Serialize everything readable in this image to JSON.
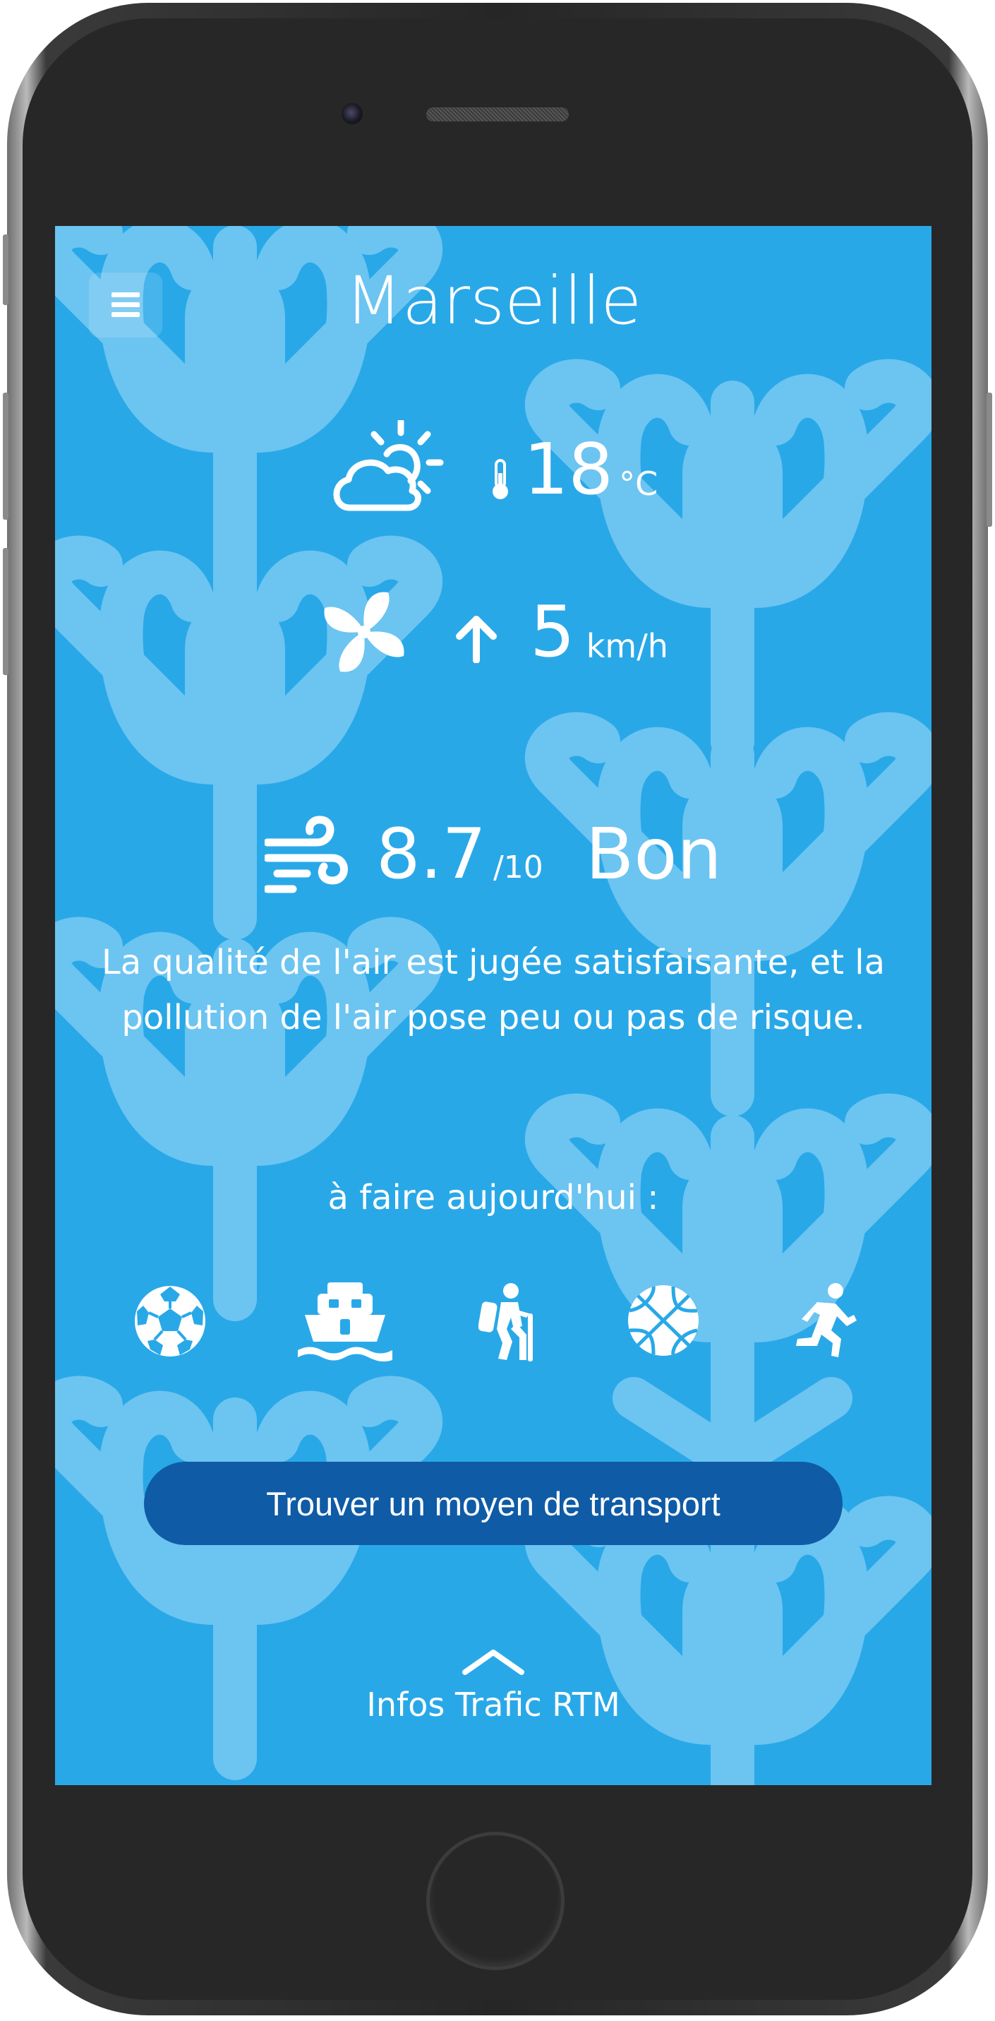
{
  "header": {
    "city": "Marseille",
    "menu_icon": "hamburger-menu-icon"
  },
  "weather": {
    "condition_icon": "partly-cloudy-sun-icon",
    "temperature": "18",
    "temperature_unit": "°C",
    "wind_icon": "wind-fan-icon",
    "wind_direction_icon": "arrow-up-icon",
    "wind_speed": "5",
    "wind_speed_unit": "km/h"
  },
  "air_quality": {
    "icon": "air-wind-icon",
    "score": "8.7",
    "scale": "/10",
    "label": "Bon",
    "description": "La qualité de l'air est jugée satisfaisante, et la pollution de l'air pose peu ou pas de risque."
  },
  "activities": {
    "label": "à faire aujourd'hui :",
    "items": [
      "soccer-ball-icon",
      "ferry-boat-icon",
      "hiking-icon",
      "basketball-icon",
      "running-icon"
    ]
  },
  "transport_button": {
    "label": "Trouver un moyen de transport"
  },
  "traffic": {
    "icon": "chevron-up-icon",
    "label": "Infos Trafic RTM"
  },
  "colors": {
    "screen_bg": "#29a8e8",
    "pattern": "#6cc4f1",
    "button": "#0f5ba6",
    "text": "#ffffff",
    "phone_body": "#272727"
  }
}
